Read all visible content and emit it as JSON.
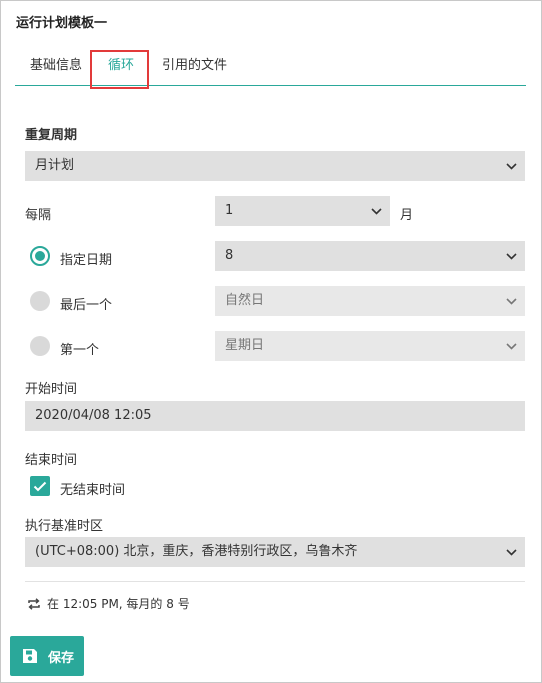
{
  "window": {
    "title": "运行计划模板一"
  },
  "tabs": [
    {
      "label": "基础信息"
    },
    {
      "label": "循环"
    },
    {
      "label": "引用的文件"
    }
  ],
  "form": {
    "repeat_period_label": "重复周期",
    "repeat_period_value": "月计划",
    "every_label": "每隔",
    "every_value": "1",
    "every_unit": "月",
    "specified_date_label": "指定日期",
    "specified_date_value": "8",
    "last_one_label": "最后一个",
    "last_one_value": "自然日",
    "first_one_label": "第一个",
    "first_one_value": "星期日",
    "start_time_label": "开始时间",
    "start_time_value": "2020/04/08 12:05",
    "end_time_label": "结束时间",
    "no_end_time_label": "无结束时间",
    "no_end_time_checked": true,
    "timezone_label": "执行基准时区",
    "timezone_value": "(UTC+08:00) 北京，重庆，香港特别行政区，乌鲁木齐"
  },
  "summary": {
    "text": "在 12:05 PM, 每月的 8 号",
    "icon": "repeat-icon"
  },
  "actions": {
    "save_label": "保存",
    "save_icon": "floppy-disk-icon"
  },
  "colors": {
    "accent": "#2aa89a",
    "highlight": "#e23a3a"
  }
}
